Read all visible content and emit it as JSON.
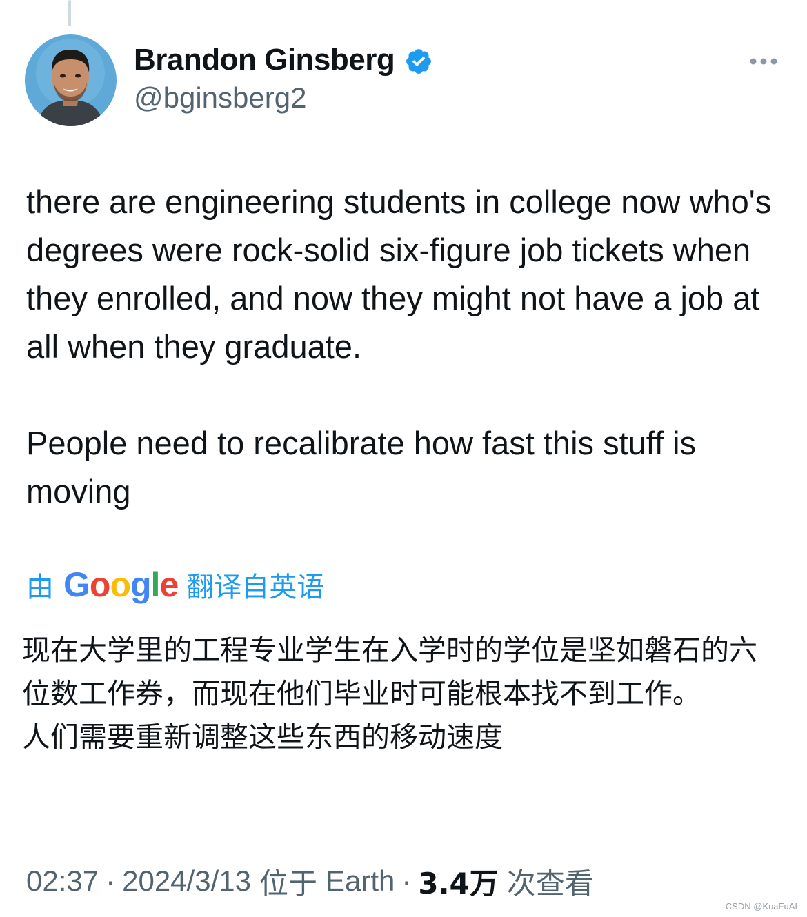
{
  "author": {
    "display_name": "Brandon Ginsberg",
    "handle": "@bginsberg2",
    "avatar_icon": "profile-photo",
    "verified_icon": "verified-badge-icon"
  },
  "tweet": {
    "paragraph_1": "there are engineering students in college now who's degrees were rock-solid six-figure job tickets when they enrolled, and now they might not have a job at all when they graduate.",
    "paragraph_2": "People need to recalibrate how fast this stuff is moving"
  },
  "translation": {
    "by_label": "由",
    "google_letters": [
      "G",
      "o",
      "o",
      "g",
      "l",
      "e"
    ],
    "from_label": "翻译自英语",
    "paragraph_1": "现在大学里的工程专业学生在入学时的学位是坚如磐石的六位数工作券，而现在他们毕业时可能根本找不到工作。",
    "paragraph_2": "人们需要重新调整这些东西的移动速度"
  },
  "meta": {
    "time": "02:37",
    "date": "2024/3/13",
    "location_prefix": "位于",
    "location": "Earth",
    "views_count": "3.4万",
    "views_label": "次查看",
    "separator": "·"
  },
  "watermark": "CSDN @KuaFuAI",
  "colors": {
    "accent": "#1d9bf0",
    "secondary_text": "#536471",
    "google_blue": "#4285f4",
    "google_red": "#ea4335",
    "google_yellow": "#fbbc05",
    "google_green": "#34a853"
  }
}
